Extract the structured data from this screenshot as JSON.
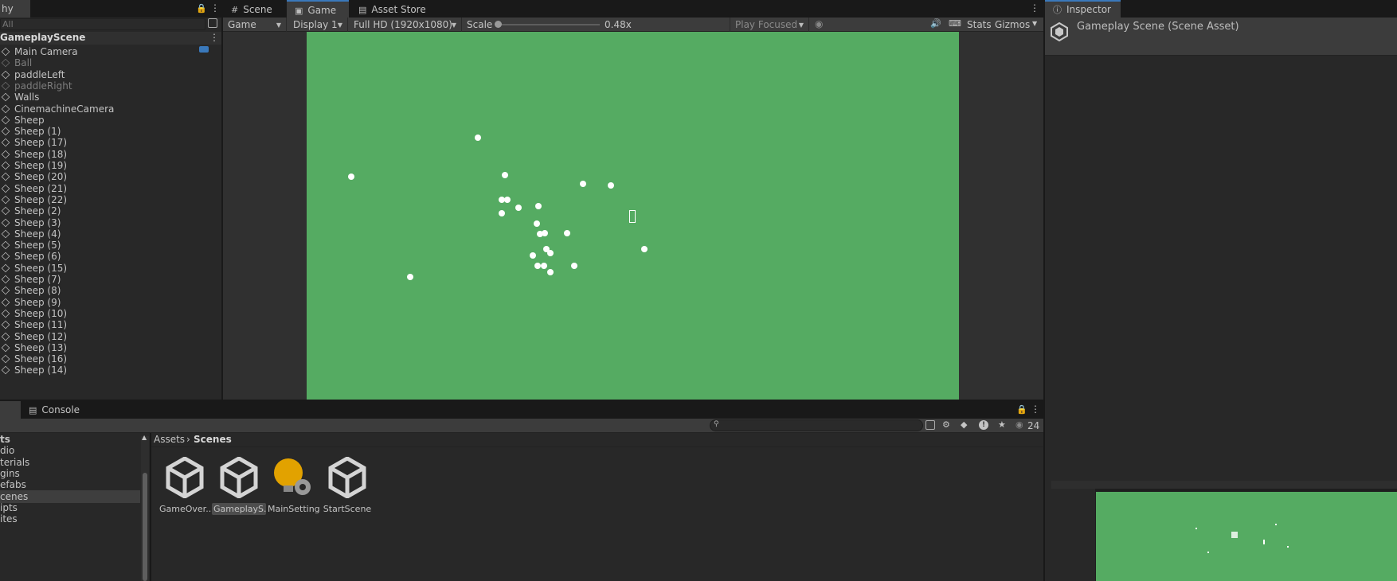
{
  "hierarchy": {
    "tab_label": "hy",
    "search_placeholder": "All",
    "scene_name": "GameplayScene",
    "items": [
      {
        "label": "Main Camera",
        "dim": false
      },
      {
        "label": "Ball",
        "dim": true
      },
      {
        "label": "paddleLeft",
        "dim": false
      },
      {
        "label": "paddleRight",
        "dim": true
      },
      {
        "label": "Walls",
        "dim": false
      },
      {
        "label": "CinemachineCamera",
        "dim": false
      },
      {
        "label": "Sheep",
        "dim": false
      },
      {
        "label": "Sheep (1)",
        "dim": false
      },
      {
        "label": "Sheep (17)",
        "dim": false
      },
      {
        "label": "Sheep (18)",
        "dim": false
      },
      {
        "label": "Sheep (19)",
        "dim": false
      },
      {
        "label": "Sheep (20)",
        "dim": false
      },
      {
        "label": "Sheep (21)",
        "dim": false
      },
      {
        "label": "Sheep (22)",
        "dim": false
      },
      {
        "label": "Sheep (2)",
        "dim": false
      },
      {
        "label": "Sheep (3)",
        "dim": false
      },
      {
        "label": "Sheep (4)",
        "dim": false
      },
      {
        "label": "Sheep (5)",
        "dim": false
      },
      {
        "label": "Sheep (6)",
        "dim": false
      },
      {
        "label": "Sheep (15)",
        "dim": false
      },
      {
        "label": "Sheep (7)",
        "dim": false
      },
      {
        "label": "Sheep (8)",
        "dim": false
      },
      {
        "label": "Sheep (9)",
        "dim": false
      },
      {
        "label": "Sheep (10)",
        "dim": false
      },
      {
        "label": "Sheep (11)",
        "dim": false
      },
      {
        "label": "Sheep (12)",
        "dim": false
      },
      {
        "label": "Sheep (13)",
        "dim": false
      },
      {
        "label": "Sheep (16)",
        "dim": false
      },
      {
        "label": "Sheep (14)",
        "dim": false
      }
    ]
  },
  "center_tabs": {
    "scene": "Scene",
    "game": "Game",
    "asset_store": "Asset Store"
  },
  "game_toolbar": {
    "view_mode": "Game",
    "display": "Display 1",
    "resolution": "Full HD (1920x1080)",
    "scale_label": "Scale",
    "scale_value": "0.48x",
    "play_mode": "Play Focused",
    "stats": "Stats",
    "gizmos": "Gizmos"
  },
  "game_view": {
    "background_color": "#55ab62",
    "sheep_color": "#ffffff"
  },
  "inspector": {
    "tab_label": "Inspector",
    "title": "Gameplay Scene (Scene Asset)"
  },
  "console": {
    "tab_label": "Console",
    "hidden_count": "24"
  },
  "project": {
    "folders": [
      "ts",
      "dio",
      "terials",
      "gins",
      "efabs",
      "cenes",
      "ipts",
      "ites"
    ],
    "selected_folder_index": 5,
    "breadcrumb_root": "Assets",
    "breadcrumb_current": "Scenes",
    "assets": [
      {
        "label": "GameOver...",
        "type": "unity-scene",
        "selected": false
      },
      {
        "label": "GameplayS...",
        "type": "unity-scene",
        "selected": true
      },
      {
        "label": "MainSettings",
        "type": "settings",
        "selected": false
      },
      {
        "label": "StartScene",
        "type": "unity-scene",
        "selected": false
      }
    ]
  }
}
